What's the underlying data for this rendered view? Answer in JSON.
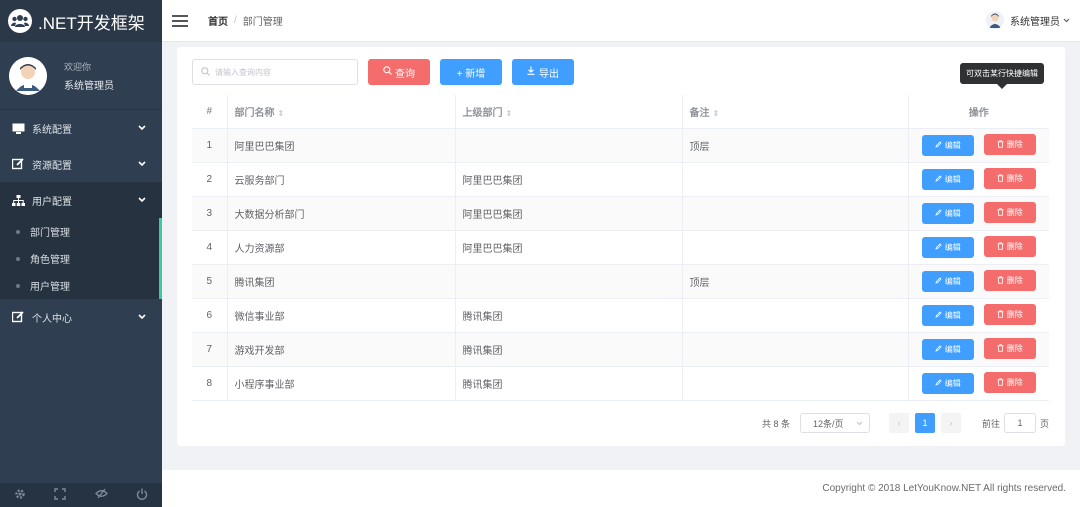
{
  "app": {
    "title": ".NET开发框架"
  },
  "user": {
    "welcome": "欢迎你",
    "name": "系统管理员"
  },
  "nav": [
    {
      "label": "系统配置",
      "icon": "monitor-icon"
    },
    {
      "label": "资源配置",
      "icon": "edit-icon"
    },
    {
      "label": "用户配置",
      "icon": "sitemap-icon"
    },
    {
      "label": "个人中心",
      "icon": "edit-icon"
    }
  ],
  "subnav": [
    "部门管理",
    "角色管理",
    "用户管理"
  ],
  "header": {
    "home": "首页",
    "sep": "/",
    "current": "部门管理",
    "user": "系统管理员"
  },
  "toolbar": {
    "search_placeholder": "请输入查询内容",
    "query": "查询",
    "add": "+ 新增",
    "export": "导出"
  },
  "tooltip": "可双击某行快捷编辑",
  "table": {
    "headers": {
      "idx": "#",
      "name": "部门名称",
      "parent": "上级部门",
      "note": "备注",
      "op": "操作"
    },
    "edit_label": "编辑",
    "delete_label": "删除",
    "rows": [
      {
        "idx": "1",
        "name": "阿里巴巴集团",
        "parent": "",
        "note": "顶层"
      },
      {
        "idx": "2",
        "name": "云服务部门",
        "parent": "阿里巴巴集团",
        "note": ""
      },
      {
        "idx": "3",
        "name": "大数据分析部门",
        "parent": "阿里巴巴集团",
        "note": ""
      },
      {
        "idx": "4",
        "name": "人力资源部",
        "parent": "阿里巴巴集团",
        "note": ""
      },
      {
        "idx": "5",
        "name": "腾讯集团",
        "parent": "",
        "note": "顶层"
      },
      {
        "idx": "6",
        "name": "微信事业部",
        "parent": "腾讯集团",
        "note": ""
      },
      {
        "idx": "7",
        "name": "游戏开发部",
        "parent": "腾讯集团",
        "note": ""
      },
      {
        "idx": "8",
        "name": "小程序事业部",
        "parent": "腾讯集团",
        "note": ""
      }
    ]
  },
  "pager": {
    "total": "共 8 条",
    "page_size": "12条/页",
    "current": "1",
    "goto_label": "前往",
    "goto_value": "1",
    "page_unit": "页"
  },
  "footer": "Copyright © 2018 LetYouKnow.NET All rights reserved.",
  "colors": {
    "sidebar": "#2f3e50",
    "primary": "#409eff",
    "danger": "#f56c6c",
    "accent": "#3ac9a0"
  }
}
